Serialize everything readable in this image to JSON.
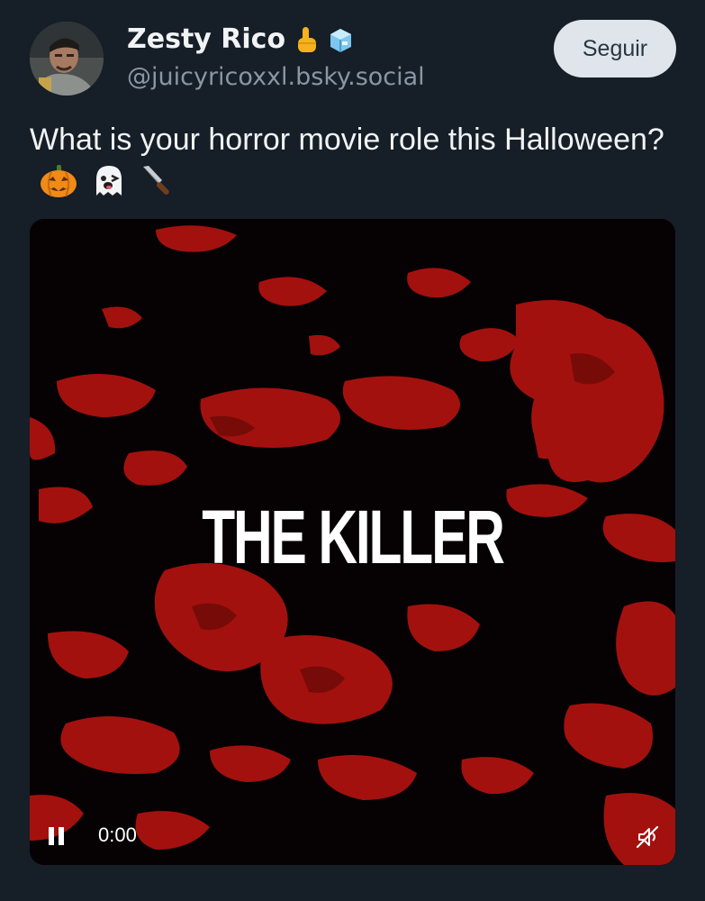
{
  "post": {
    "author": {
      "display_name": "Zesty Rico",
      "handle": "@juicyricoxxl.bsky.social",
      "name_emojis": [
        "pointing-hand-emoji",
        "ice-cube-emoji"
      ]
    },
    "follow_label": "Seguir",
    "text": "What is your horror movie role this Halloween?",
    "text_emojis": [
      "jack-o-lantern-emoji",
      "ghost-emoji",
      "knife-emoji"
    ]
  },
  "video": {
    "title": "THE KILLER",
    "time": "0:00",
    "state": "playing",
    "muted": true
  },
  "colors": {
    "background": "#161e27",
    "follow_button": "#dfe5ea",
    "blood": "#b3120f"
  }
}
